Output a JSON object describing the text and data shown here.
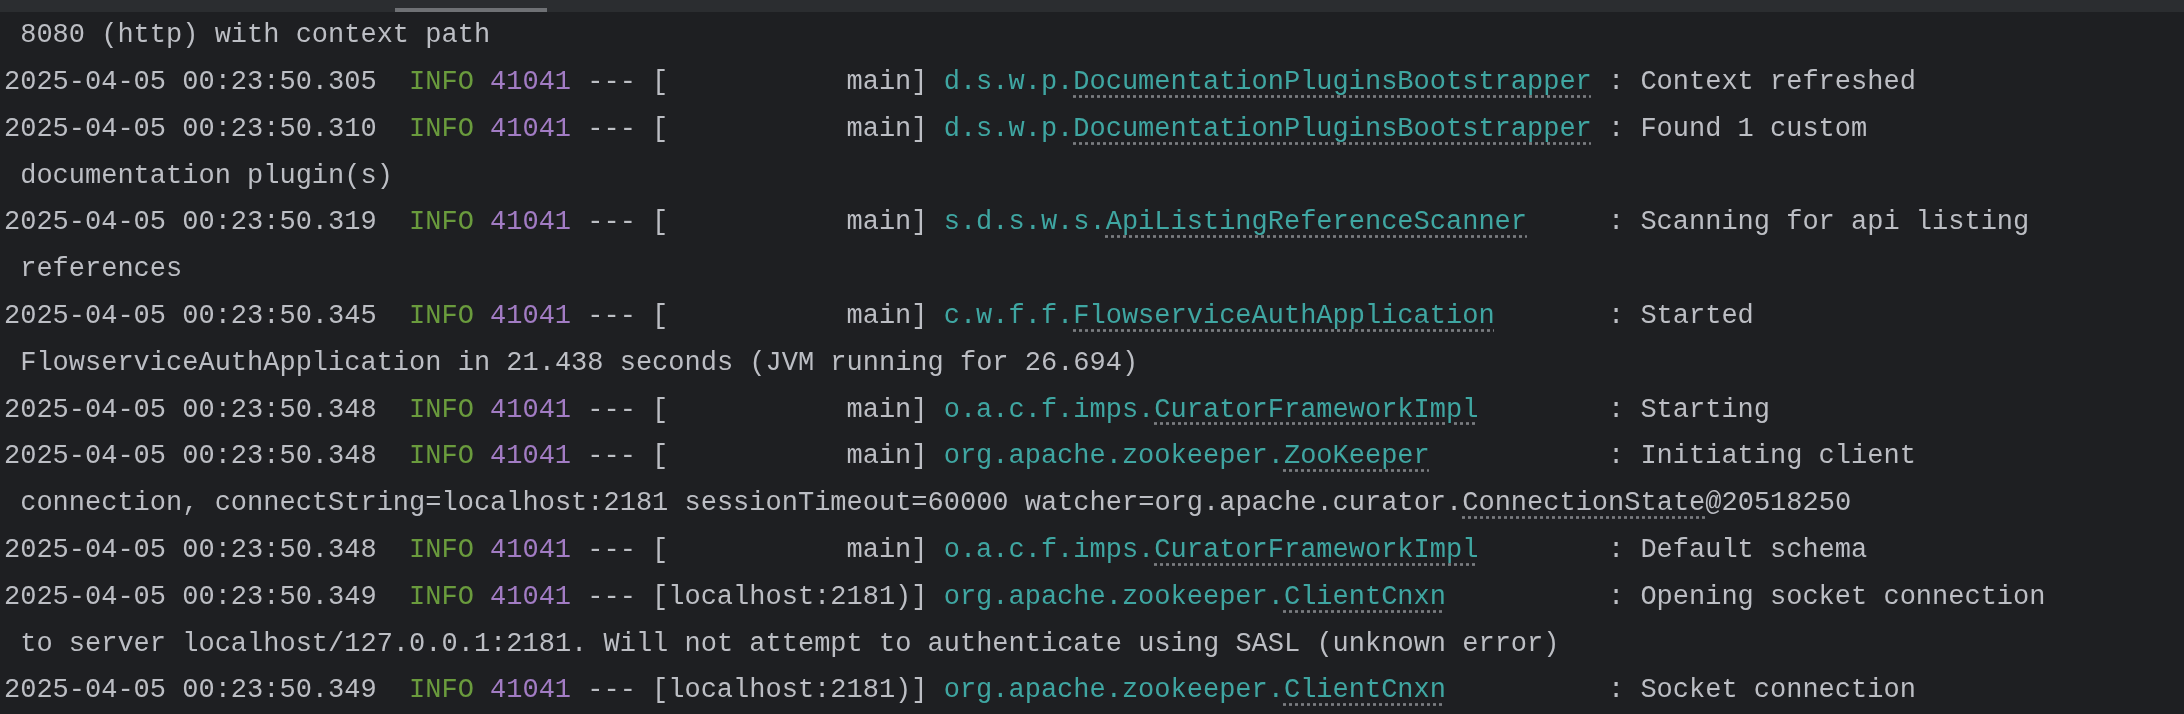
{
  "lines": [
    {
      "kind": "wrap",
      "text": " 8080 (http) with context path"
    },
    {
      "kind": "log",
      "time": "2025-04-05 00:23:50.305",
      "level": "INFO",
      "pid": "41041",
      "sep": "--- [",
      "thread": "main",
      "close": "]",
      "logger_package": "d.s.w.p.",
      "logger_class": "DocumentationPluginsBootstrapper",
      "message": ": Context refreshed"
    },
    {
      "kind": "log",
      "time": "2025-04-05 00:23:50.310",
      "level": "INFO",
      "pid": "41041",
      "sep": "--- [",
      "thread": "main",
      "close": "]",
      "logger_package": "d.s.w.p.",
      "logger_class": "DocumentationPluginsBootstrapper",
      "message": ": Found 1 custom"
    },
    {
      "kind": "wrap",
      "text": " documentation plugin(s)"
    },
    {
      "kind": "log",
      "time": "2025-04-05 00:23:50.319",
      "level": "INFO",
      "pid": "41041",
      "sep": "--- [",
      "thread": "main",
      "close": "]",
      "logger_package": "s.d.s.w.s.",
      "logger_class": "ApiListingReferenceScanner",
      "message": ": Scanning for api listing"
    },
    {
      "kind": "wrap",
      "text": " references"
    },
    {
      "kind": "log",
      "time": "2025-04-05 00:23:50.345",
      "level": "INFO",
      "pid": "41041",
      "sep": "--- [",
      "thread": "main",
      "close": "]",
      "logger_package": "c.w.f.f.",
      "logger_class": "FlowserviceAuthApplication",
      "message": ": Started"
    },
    {
      "kind": "wrap",
      "text": " FlowserviceAuthApplication in 21.438 seconds (JVM running for 26.694)"
    },
    {
      "kind": "log",
      "time": "2025-04-05 00:23:50.348",
      "level": "INFO",
      "pid": "41041",
      "sep": "--- [",
      "thread": "main",
      "close": "]",
      "logger_package": "o.a.c.f.imps.",
      "logger_class": "CuratorFrameworkImpl",
      "message": ": Starting"
    },
    {
      "kind": "log",
      "time": "2025-04-05 00:23:50.348",
      "level": "INFO",
      "pid": "41041",
      "sep": "--- [",
      "thread": "main",
      "close": "]",
      "logger_package": "org.apache.zookeeper.",
      "logger_class": "ZooKeeper",
      "message": ": Initiating client"
    },
    {
      "kind": "wrap",
      "text": " connection, connectString=localhost:2181 sessionTimeout=60000 watcher=org.apache.curator.",
      "link": "ConnectionState",
      "rest": "@20518250"
    },
    {
      "kind": "log",
      "time": "2025-04-05 00:23:50.348",
      "level": "INFO",
      "pid": "41041",
      "sep": "--- [",
      "thread": "main",
      "close": "]",
      "logger_package": "o.a.c.f.imps.",
      "logger_class": "CuratorFrameworkImpl",
      "message": ": Default schema"
    },
    {
      "kind": "log",
      "time": "2025-04-05 00:23:50.349",
      "level": "INFO",
      "pid": "41041",
      "sep": "--- [",
      "thread": "localhost:2181)",
      "close": "]",
      "logger_package": "org.apache.zookeeper.",
      "logger_class": "ClientCnxn",
      "message": ": Opening socket connection"
    },
    {
      "kind": "wrap",
      "text": " to server localhost/127.0.0.1:2181. Will not attempt to authenticate using SASL (unknown error)"
    },
    {
      "kind": "log",
      "time": "2025-04-05 00:23:50.349",
      "level": "INFO",
      "pid": "41041",
      "sep": "--- [",
      "thread": "localhost:2181)",
      "close": "]",
      "logger_package": "org.apache.zookeeper.",
      "logger_class": "ClientCnxn",
      "message": ": Socket connection"
    }
  ]
}
